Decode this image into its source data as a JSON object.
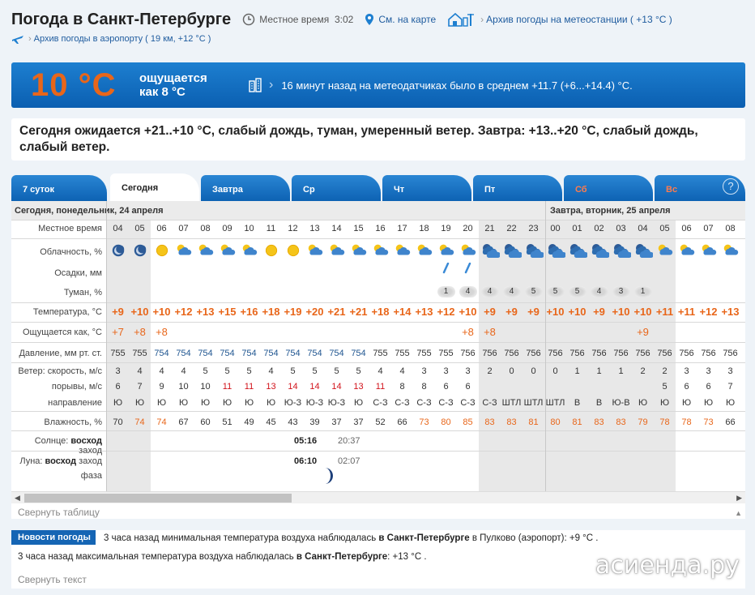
{
  "header": {
    "title": "Погода в Санкт-Петербурге",
    "local_time_label": "Местное время",
    "local_time": "3:02",
    "map_link": "См. на карте",
    "stations_link": "Архив погоды на метеостанции ( +13 °C )",
    "airport_link": "Архив погоды в аэропорту ( 19 км, +12 °C )"
  },
  "now": {
    "temp": "10 °C",
    "feels_line1": "ощущается",
    "feels_line2": "как 8 °C",
    "sensors": "16 минут назад на метеодатчиках было в среднем +11.7 (+6...+14.4) °C."
  },
  "forecast_text": "Сегодня ожидается +21..+10 °C, слабый дождь, туман, умеренный ветер. Завтра: +13..+20 °C, слабый дождь, слабый ветер.",
  "tabs": [
    {
      "label": "7 суток",
      "weekend": false
    },
    {
      "label": "Сегодня",
      "weekend": false,
      "active": true
    },
    {
      "label": "Завтра",
      "weekend": false
    },
    {
      "label": "Ср",
      "weekend": false
    },
    {
      "label": "Чт",
      "weekend": false
    },
    {
      "label": "Пт",
      "weekend": false
    },
    {
      "label": "Сб",
      "weekend": true
    },
    {
      "label": "Вс",
      "weekend": true
    }
  ],
  "help_label": "?",
  "table": {
    "day1": "Сегодня, понедельник, 24 апреля",
    "day2": "Завтра, вторник, 25 апреля",
    "labels": {
      "time": "Местное время",
      "clouds": "Облачность, %",
      "precip": "Осадки, мм",
      "fog": "Туман, %",
      "temp": "Температура, °C",
      "feels": "Ощущается как, °C",
      "pressure": "Давление, мм рт. ст.",
      "wind_speed": "Ветер: скорость, м/с",
      "gusts": "порывы, м/с",
      "direction": "направление",
      "humidity": "Влажность, %",
      "sun_prefix": "Солнце:",
      "sun_rise": "восход",
      "sun_set": "заход",
      "moon_prefix": "Луна:",
      "moon_rise": "восход",
      "moon_set": "заход",
      "phase": "фаза"
    },
    "hours": [
      "04",
      "05",
      "06",
      "07",
      "08",
      "09",
      "10",
      "11",
      "12",
      "13",
      "14",
      "15",
      "16",
      "17",
      "18",
      "19",
      "20",
      "21",
      "22",
      "23",
      "00",
      "01",
      "02",
      "03",
      "04",
      "05",
      "06",
      "07",
      "08"
    ],
    "cloud_icons": [
      "night-clear",
      "night-clear",
      "sun",
      "sun-cloud",
      "sun-cloud",
      "sun-cloud",
      "sun-cloud",
      "sun",
      "sun",
      "sun-cloud",
      "sun-cloud",
      "sun-cloud",
      "sun-cloud",
      "sun-cloud",
      "sun-cloud",
      "sun-cloud",
      "sun-cloud",
      "night-cloud",
      "night-cloud",
      "night-cloud",
      "night-cloud",
      "night-cloud",
      "night-cloud",
      "night-cloud",
      "night-cloud",
      "sun-cloud",
      "sun-cloud",
      "sun-cloud",
      "sun-cloud"
    ],
    "precip": [
      "",
      "",
      "",
      "",
      "",
      "",
      "",
      "",
      "",
      "",
      "",
      "",
      "",
      "",
      "",
      "drop",
      "drop",
      "",
      "",
      "",
      "",
      "",
      "",
      "",
      "",
      "",
      "",
      "",
      ""
    ],
    "fog": [
      "",
      "",
      "",
      "",
      "",
      "",
      "",
      "",
      "",
      "",
      "",
      "",
      "",
      "",
      "",
      "1",
      "4",
      "4",
      "4",
      "5",
      "5",
      "5",
      "4",
      "3",
      "1",
      "",
      "",
      "",
      ""
    ],
    "temp": [
      "+9",
      "+10",
      "+10",
      "+12",
      "+13",
      "+15",
      "+16",
      "+18",
      "+19",
      "+20",
      "+21",
      "+21",
      "+18",
      "+14",
      "+13",
      "+12",
      "+10",
      "+9",
      "+9",
      "+9",
      "+10",
      "+10",
      "+9",
      "+10",
      "+10",
      "+11",
      "+11",
      "+12",
      "+13"
    ],
    "feels": [
      "+7",
      "+8",
      "+8",
      "",
      "",
      "",
      "",
      "",
      "",
      "",
      "",
      "",
      "",
      "",
      "",
      "",
      "+8",
      "+8",
      "",
      "",
      "",
      "",
      "",
      "",
      "+9",
      "",
      "",
      "",
      ""
    ],
    "pressure": [
      "755",
      "755",
      "754",
      "754",
      "754",
      "754",
      "754",
      "754",
      "754",
      "754",
      "754",
      "754",
      "755",
      "755",
      "755",
      "755",
      "756",
      "756",
      "756",
      "756",
      "756",
      "756",
      "756",
      "756",
      "756",
      "756",
      "756",
      "756",
      "756"
    ],
    "wind": [
      "3",
      "4",
      "4",
      "4",
      "5",
      "5",
      "5",
      "4",
      "5",
      "5",
      "5",
      "5",
      "4",
      "4",
      "3",
      "3",
      "3",
      "2",
      "0",
      "0",
      "0",
      "1",
      "1",
      "1",
      "2",
      "2",
      "3",
      "3",
      "3"
    ],
    "gusts": [
      "6",
      "7",
      "9",
      "10",
      "10",
      "11",
      "11",
      "13",
      "14",
      "14",
      "14",
      "13",
      "11",
      "8",
      "8",
      "6",
      "6",
      "",
      "",
      "",
      "",
      "",
      "",
      "",
      "",
      "5",
      "6",
      "6",
      "7"
    ],
    "gust_colors": [
      "",
      "",
      "",
      "",
      "",
      "red",
      "red",
      "red",
      "red",
      "red",
      "red",
      "red",
      "red",
      "",
      "",
      "",
      "",
      "",
      "",
      "",
      "",
      "",
      "",
      "",
      "",
      "",
      "",
      "",
      ""
    ],
    "direction": [
      "Ю",
      "Ю",
      "Ю",
      "Ю",
      "Ю",
      "Ю",
      "Ю",
      "Ю",
      "Ю-З",
      "Ю-З",
      "Ю-З",
      "Ю",
      "С-З",
      "С-З",
      "С-З",
      "С-З",
      "С-З",
      "С-З",
      "ШТЛ",
      "ШТЛ",
      "ШТЛ",
      "В",
      "В",
      "Ю-В",
      "Ю",
      "Ю",
      "Ю",
      "Ю",
      "Ю"
    ],
    "humidity": [
      "70",
      "74",
      "74",
      "67",
      "60",
      "51",
      "49",
      "45",
      "43",
      "39",
      "37",
      "37",
      "52",
      "66",
      "73",
      "80",
      "85",
      "83",
      "83",
      "81",
      "80",
      "81",
      "83",
      "83",
      "79",
      "78",
      "78",
      "73",
      "66"
    ],
    "humidity_colors": [
      "",
      "o",
      "o",
      "",
      "",
      "",
      "",
      "",
      "",
      "",
      "",
      "",
      "",
      "",
      "o",
      "o",
      "o",
      "o",
      "o",
      "o",
      "o",
      "o",
      "o",
      "o",
      "o",
      "o",
      "o",
      "o",
      ""
    ],
    "sunrise": "05:16",
    "sunset": "20:37",
    "moonrise": "06:10",
    "moonset": "02:07",
    "collapse": "Свернуть таблицу"
  },
  "news": {
    "badge": "Новости погоды",
    "line1_pre": "3 часа назад минимальная температура воздуха наблюдалась ",
    "line1_city": "в Санкт-Петербурге",
    "line1_post": " в Пулково (аэропорт): +9 °C .",
    "line2_pre": "3 часа назад максимальная температура воздуха наблюдалась ",
    "line2_city": "в Санкт-Петербурге",
    "line2_post": ": +13 °C .",
    "collapse": "Свернуть текст"
  },
  "watermark": "асиенда.ру",
  "colors": {
    "accent": "#1565b4",
    "warm": "#e8661a",
    "gust_red": "#d2131b"
  }
}
